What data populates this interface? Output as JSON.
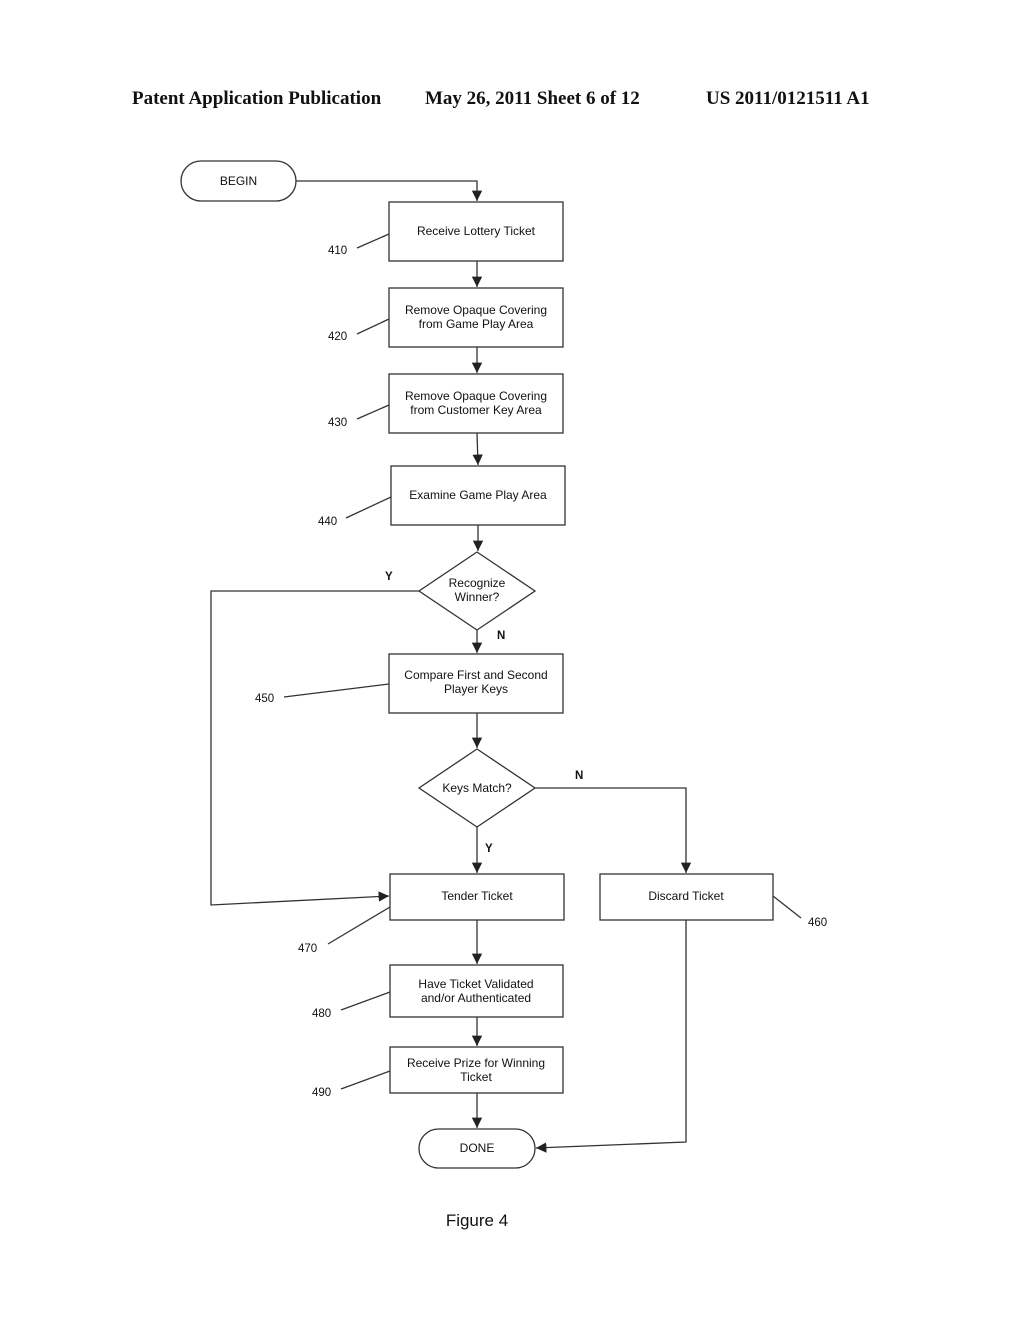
{
  "header": {
    "publication": "Patent Application Publication",
    "date_sheet": "May 26, 2011   Sheet 6 of 12",
    "number": "US 2011/0121511 A1"
  },
  "flowchart": {
    "begin": "BEGIN",
    "done": "DONE",
    "steps": [
      {
        "ref": "410",
        "lines": [
          "Receive Lottery Ticket"
        ]
      },
      {
        "ref": "420",
        "lines": [
          "Remove Opaque Covering",
          "from Game Play Area"
        ]
      },
      {
        "ref": "430",
        "lines": [
          "Remove Opaque Covering",
          "from Customer Key Area"
        ]
      },
      {
        "ref": "440",
        "lines": [
          "Examine Game Play Area"
        ]
      },
      {
        "ref": "450",
        "lines": [
          "Compare First and Second",
          "Player Keys"
        ]
      },
      {
        "ref": "460",
        "lines": [
          "Discard Ticket"
        ]
      },
      {
        "ref": "470",
        "lines": [
          "Tender Ticket"
        ]
      },
      {
        "ref": "480",
        "lines": [
          "Have Ticket Validated",
          "and/or Authenticated"
        ]
      },
      {
        "ref": "490",
        "lines": [
          "Receive Prize for Winning",
          "Ticket"
        ]
      }
    ],
    "decisions": [
      {
        "lines": [
          "Recognize",
          "Winner?"
        ],
        "yes": "Y",
        "no": "N"
      },
      {
        "lines": [
          "Keys Match?"
        ],
        "yes": "Y",
        "no": "N"
      }
    ]
  },
  "caption": "Figure 4"
}
